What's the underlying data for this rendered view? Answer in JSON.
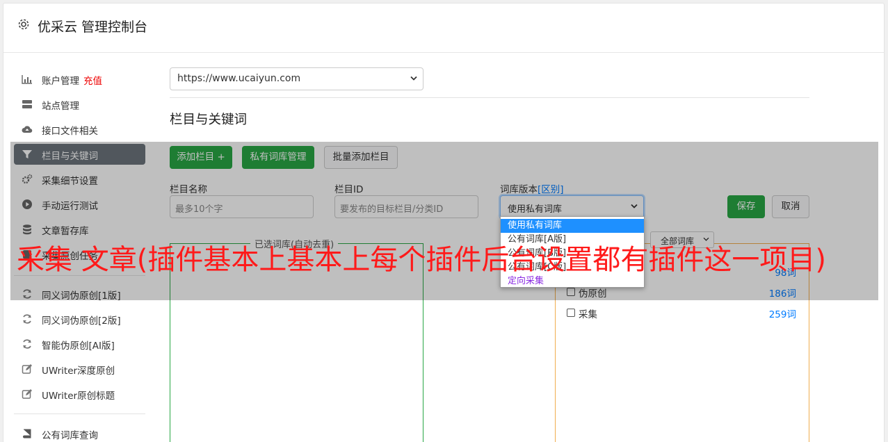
{
  "header": {
    "title": "优采云 管理控制台",
    "icon": "gear-icon"
  },
  "sidebar": {
    "recharge": "充值",
    "items": [
      {
        "label": "账户管理",
        "icon": "bar-chart-icon"
      },
      {
        "label": "站点管理",
        "icon": "server-icon"
      },
      {
        "label": "接口文件相关",
        "icon": "cloud-upload-icon"
      },
      {
        "label": "栏目与关键词",
        "icon": "filter-icon"
      },
      {
        "label": "采集细节设置",
        "icon": "gears-icon"
      },
      {
        "label": "手动运行测试",
        "icon": "play-circle-icon"
      },
      {
        "label": "文章暂存库",
        "icon": "database-icon"
      },
      {
        "label": "采集原创任务",
        "icon": "tasks-icon"
      },
      {
        "label": "同义词伪原创[1版]",
        "icon": "refresh-icon"
      },
      {
        "label": "同义词伪原创[2版]",
        "icon": "refresh-icon"
      },
      {
        "label": "智能伪原创[AI版]",
        "icon": "refresh-icon"
      },
      {
        "label": "UWriter深度原创",
        "icon": "edit-icon"
      },
      {
        "label": "UWriter原创标题",
        "icon": "edit-icon"
      },
      {
        "label": "公有词库查询",
        "icon": "book-icon"
      }
    ]
  },
  "main": {
    "site_select": "https://www.ucaiyun.com",
    "section_title": "栏目与关键词",
    "buttons": {
      "add_column": "添加栏目 +",
      "private_lib": "私有词库管理",
      "batch_add": "批量添加栏目",
      "save": "保存",
      "cancel": "取消"
    },
    "form": {
      "name_label": "栏目名称",
      "name_placeholder": "最多10个字",
      "id_label": "栏目ID",
      "id_placeholder": "要发布的目标栏目/分类ID",
      "version_label": "词库版本",
      "version_link": "[区别]",
      "version_value": "使用私有词库"
    },
    "dropdown_options": [
      "使用私有词库",
      "公有词库[A版]",
      "公有词库[B版]",
      "公有词库[C版]",
      "定向采集"
    ],
    "selected_box_title": "已选词库(自动去重)",
    "filter_value": "全部词库",
    "libraries": [
      {
        "name": "",
        "count": "98词"
      },
      {
        "name": "伪原创",
        "count": "186词"
      },
      {
        "name": "采集",
        "count": "259词"
      }
    ]
  },
  "caption": "采集 文章(插件基本上基本上每个插件后台设置都有插件这一项目)",
  "colors": {
    "green": "#28a745",
    "active": "#6c757d",
    "link": "#007bff",
    "caption": "#ff1a1a"
  }
}
